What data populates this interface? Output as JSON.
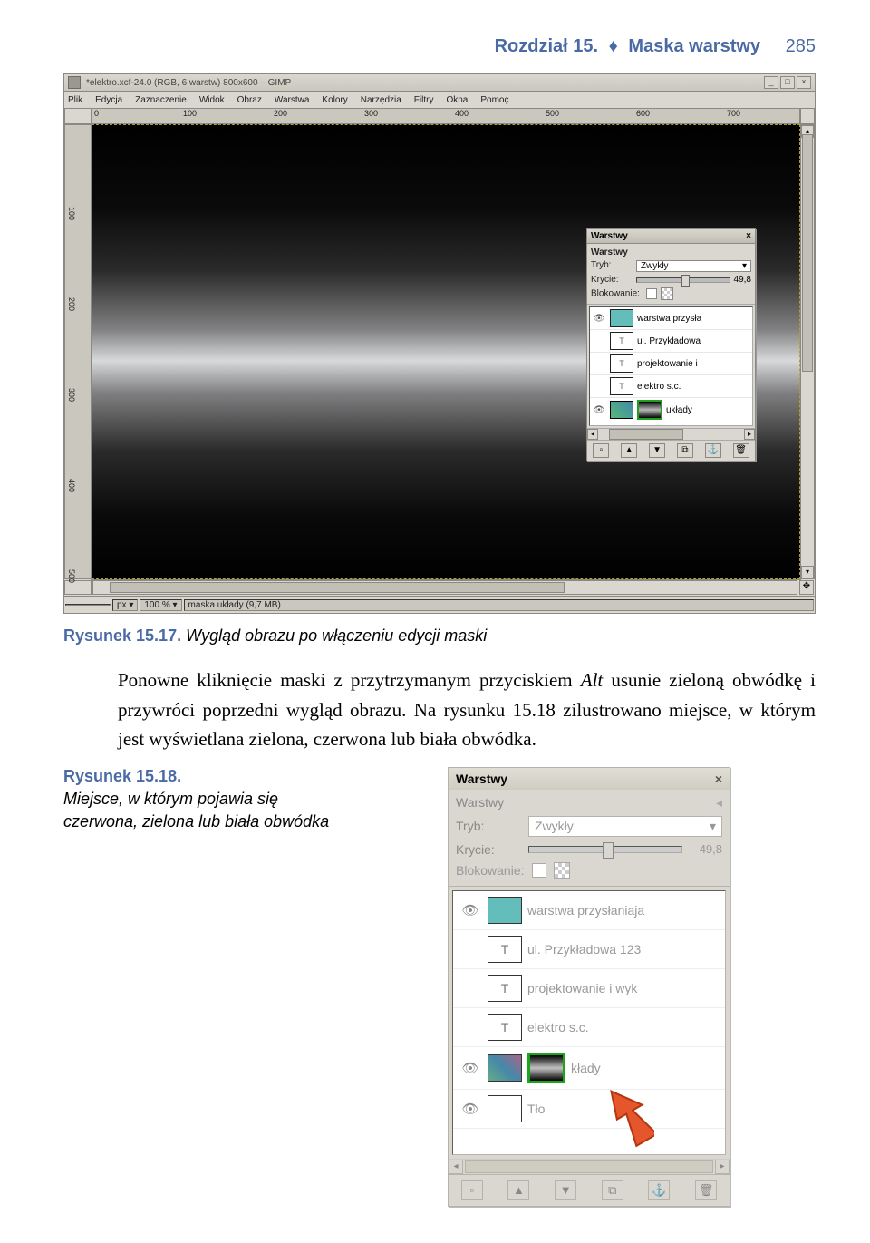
{
  "header": {
    "chapter": "Rozdział 15.",
    "title": "Maska warstwy",
    "page": "285"
  },
  "gimp": {
    "titlebar": "*elektro.xcf-24.0 (RGB, 6 warstw) 800x600 – GIMP",
    "menu": {
      "plik": "Plik",
      "edycja": "Edycja",
      "zaznaczenie": "Zaznaczenie",
      "widok": "Widok",
      "obraz": "Obraz",
      "warstwa": "Warstwa",
      "kolory": "Kolory",
      "narzedzia": "Narzędzia",
      "filtry": "Filtry",
      "okna": "Okna",
      "pomoc": "Pomoc̨"
    },
    "hruler": [
      "0",
      "100",
      "200",
      "300",
      "400",
      "500",
      "600",
      "700"
    ],
    "vruler": [
      "100",
      "200",
      "300",
      "400",
      "500"
    ],
    "status": {
      "unit": "px",
      "zoom": "100 %",
      "info": "maska układy (9,7 MB)"
    }
  },
  "layersSmall": {
    "title": "Warstwy",
    "section": "Warstwy",
    "mode_lbl": "Tryb:",
    "mode_val": "Zwykły",
    "opacity_lbl": "Krycie:",
    "opacity_val": "49,8",
    "lock_lbl": "Blokowanie:",
    "rows": [
      {
        "label": "warstwa przysła"
      },
      {
        "label": "ul. Przykładowa"
      },
      {
        "label": "projektowanie i "
      },
      {
        "label": "elektro s.c."
      },
      {
        "label": "układy"
      }
    ]
  },
  "caption1": {
    "ref": "Rysunek 15.17.",
    "text": "Wygląd obrazu po włączeniu edycji maski"
  },
  "body": {
    "p1a": "Ponowne kliknięcie maski z przytrzymanym przyciskiem ",
    "p1b": "Alt",
    "p1c": " usunie zieloną obwódkę i przywróci poprzedni wygląd obrazu. Na rysunku 15.18 zilustrowano miejsce, w którym jest wyświetlana zielona, czerwona lub biała obwódka."
  },
  "caption2": {
    "ref": "Rysunek 15.18.",
    "text": "Miejsce, w którym pojawia się czerwona, zielona lub biała obwódka"
  },
  "layersBig": {
    "title": "Warstwy",
    "section": "Warstwy",
    "mode_lbl": "Tryb:",
    "mode_val": "Zwykły",
    "opacity_lbl": "Krycie:",
    "opacity_val": "49,8",
    "lock_lbl": "Blokowanie:",
    "rows": [
      {
        "label": "warstwa przysłaniaja"
      },
      {
        "label": "ul. Przykładowa 123"
      },
      {
        "label": "projektowanie i wyk"
      },
      {
        "label": "elektro s.c."
      },
      {
        "label": "kłady"
      },
      {
        "label": "Tło"
      }
    ]
  }
}
